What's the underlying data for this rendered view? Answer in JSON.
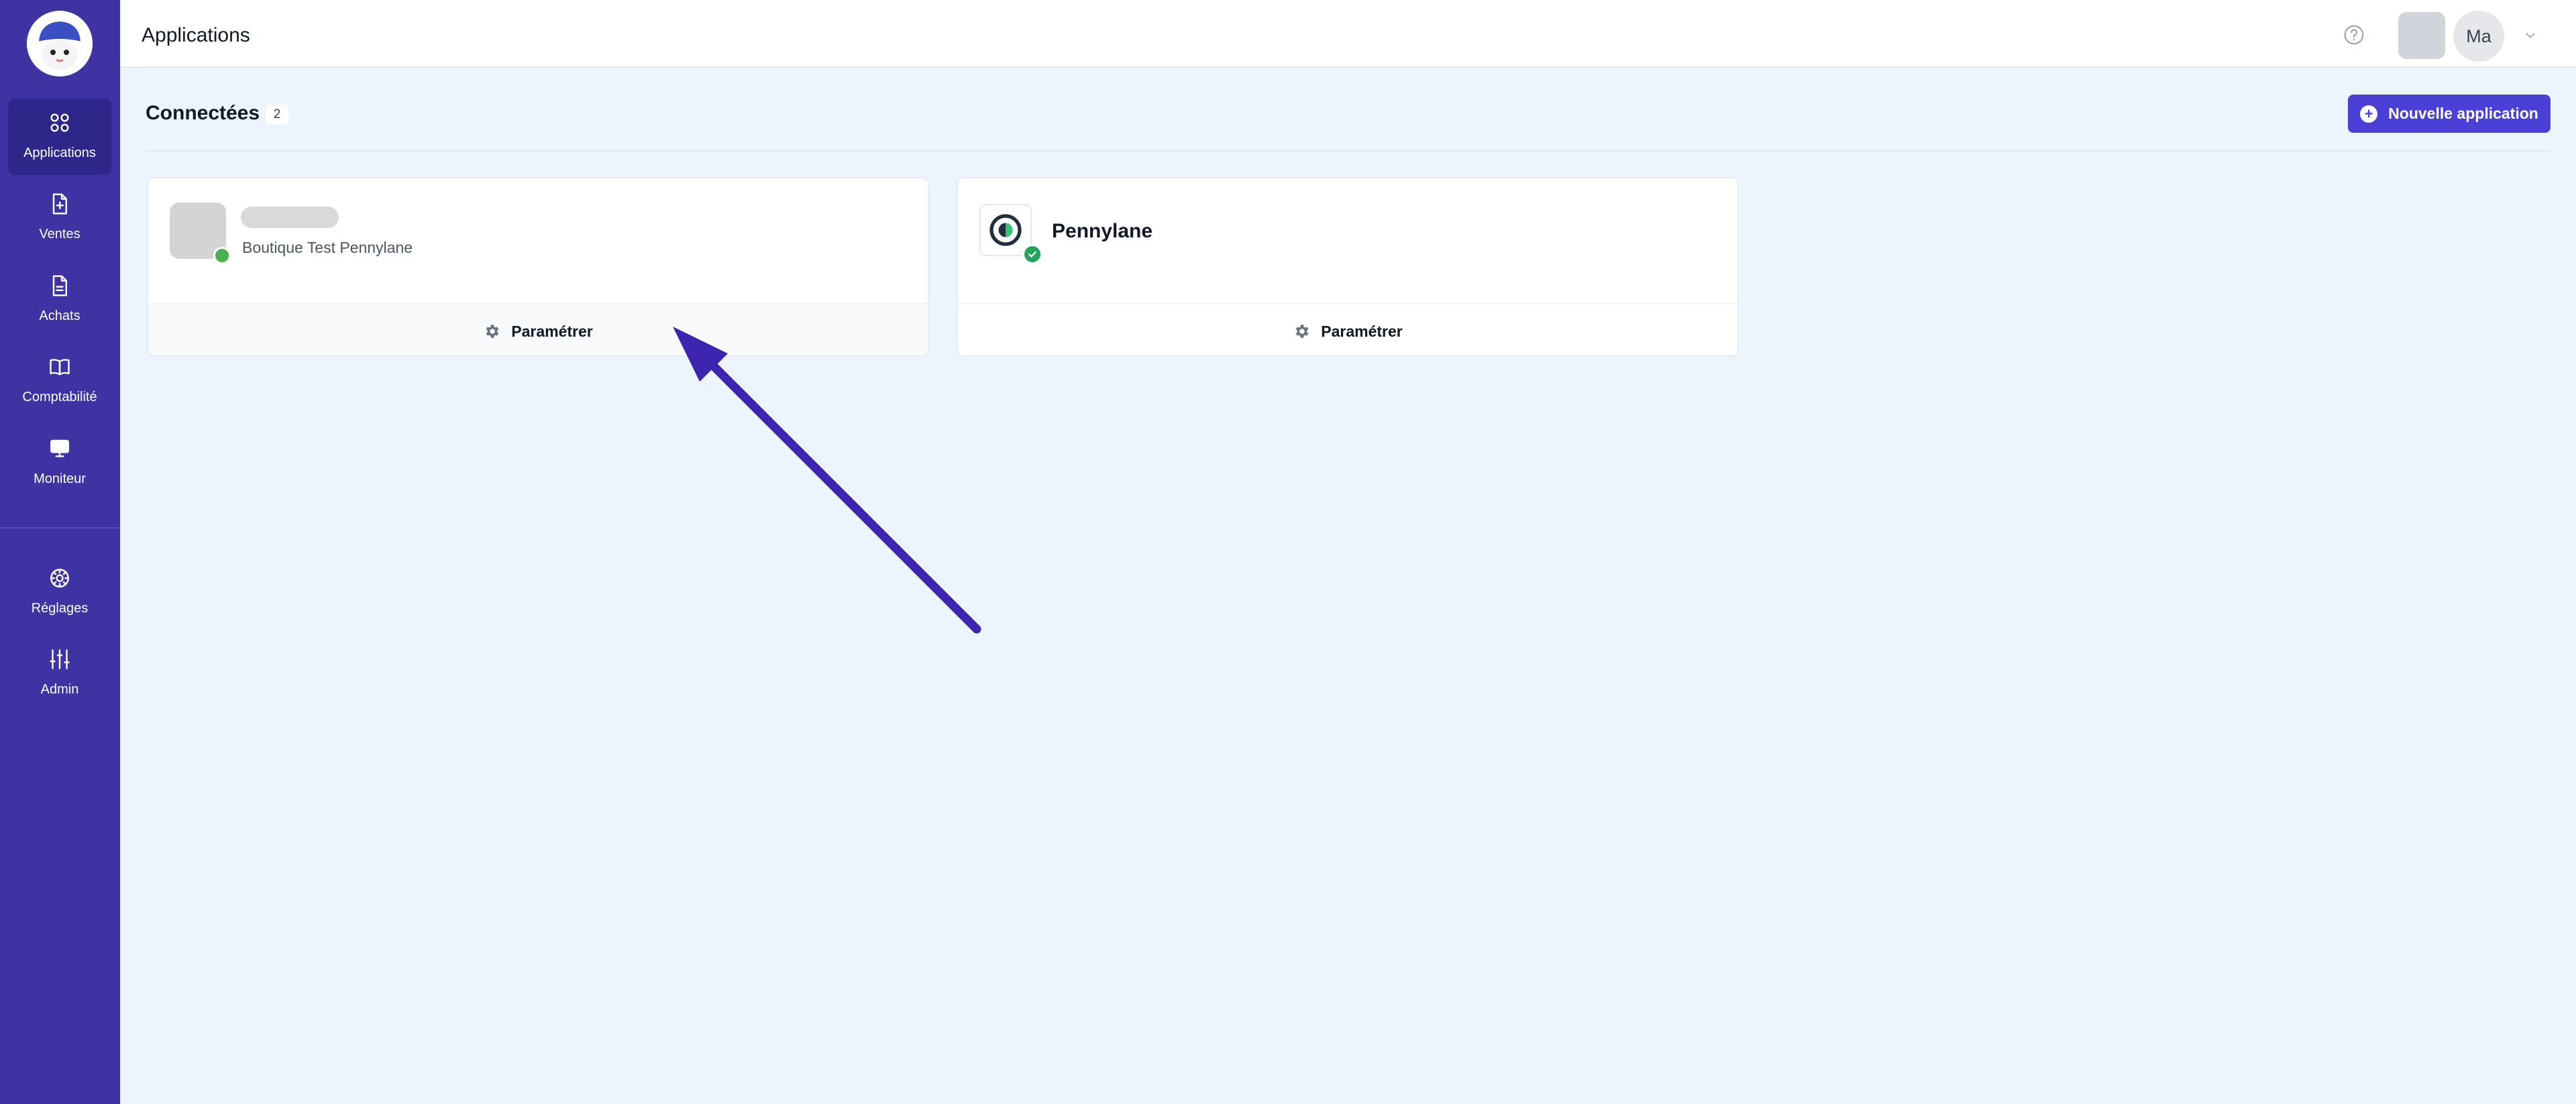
{
  "header": {
    "title": "Applications",
    "user_initials": "Ma"
  },
  "sidebar": {
    "items": [
      {
        "label": "Applications",
        "icon": "grid-icon"
      },
      {
        "label": "Ventes",
        "icon": "invoice-plus-icon"
      },
      {
        "label": "Achats",
        "icon": "document-icon"
      },
      {
        "label": "Comptabilité",
        "icon": "book-icon"
      },
      {
        "label": "Moniteur",
        "icon": "monitor-icon"
      },
      {
        "label": "Réglages",
        "icon": "gear-icon"
      },
      {
        "label": "Admin",
        "icon": "sliders-icon"
      }
    ]
  },
  "main": {
    "section_title": "Connectées",
    "count": "2",
    "new_app_label": "Nouvelle application",
    "cards": [
      {
        "subtitle": "Boutique Test Pennylane",
        "action_label": "Paramétrer"
      },
      {
        "name": "Pennylane",
        "action_label": "Paramétrer"
      }
    ]
  },
  "colors": {
    "sidebar": "#3f33a3",
    "accent": "#4a3fd6",
    "success": "#4caf50",
    "annotation_arrow": "#3d25b0"
  }
}
